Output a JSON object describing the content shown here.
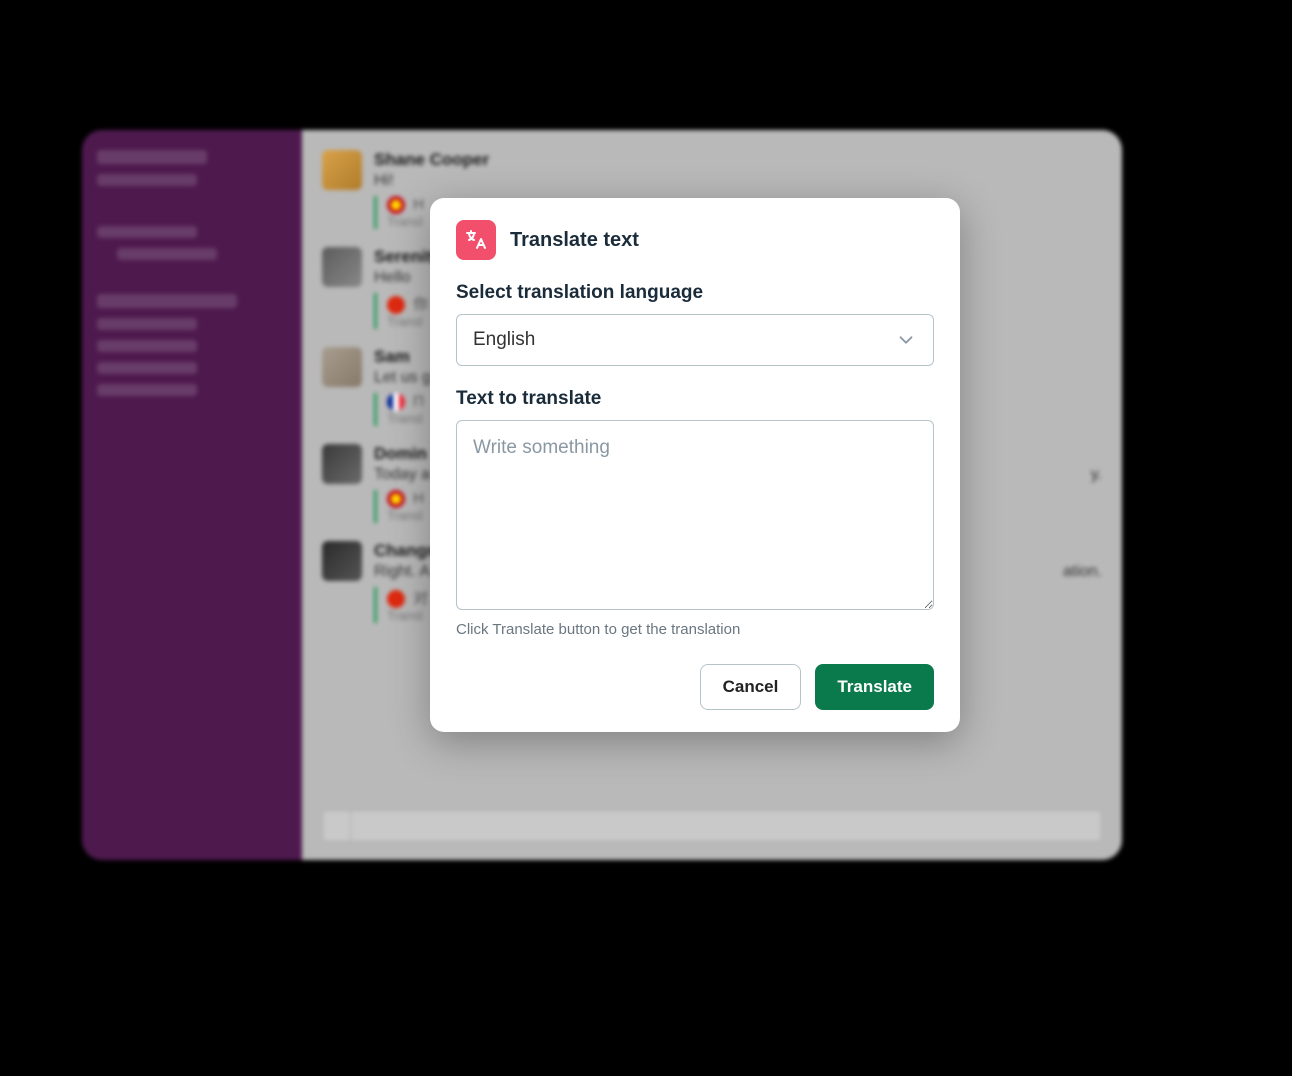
{
  "background": {
    "messages": [
      {
        "name": "Shane Cooper",
        "text": "Hi!",
        "flag": "es",
        "trans_preview": "H",
        "trans_sub": "Transl"
      },
      {
        "name": "Serenity",
        "text": "Hello",
        "flag": "cn",
        "trans_preview": "你",
        "trans_sub": "Transl"
      },
      {
        "name": "Sam",
        "text": "Let us g",
        "flag": "fr",
        "trans_preview": "П",
        "trans_sub": "Transl"
      },
      {
        "name": "Domin",
        "text": "Today a",
        "tail": "y.",
        "flag": "es",
        "trans_preview": "H",
        "trans_sub": "Transl"
      },
      {
        "name": "Changm",
        "text": "Right. A",
        "tail": "ation.",
        "flag": "cn",
        "trans_preview": "对",
        "trans_sub": "Transl"
      }
    ]
  },
  "modal": {
    "title": "Translate text",
    "language_label": "Select translation language",
    "language_value": "English",
    "text_label": "Text to translate",
    "text_placeholder": "Write something",
    "help": "Click Translate button to get the translation",
    "cancel": "Cancel",
    "submit": "Translate"
  },
  "colors": {
    "sidebar": "#4e1a4e",
    "primary_button": "#0a7a4d",
    "app_icon": "#f14f6b"
  }
}
